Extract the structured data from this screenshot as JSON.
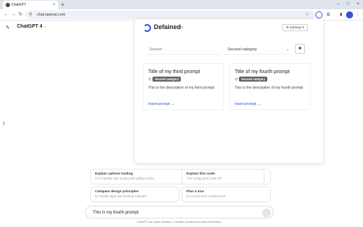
{
  "browser": {
    "tab_title": "ChatGPT",
    "tab_close": "×",
    "new_tab": "+",
    "url": "chat.openai.com",
    "window_controls": [
      "–",
      "□",
      "×"
    ],
    "nav": {
      "back": "←",
      "forward": "→",
      "reload": "↻"
    }
  },
  "chat": {
    "model_title": "ChatGPT 4",
    "suggestions": [
      {
        "title": "Explain options trading",
        "subtitle": "if I'm familiar with buying and selling stocks"
      },
      {
        "title": "Explain this code:",
        "subtitle": "\"cat config.yaml | awk NF\""
      },
      {
        "title": "Compare design principles",
        "subtitle": "for mobile apps and desktop software"
      },
      {
        "title": "Plan a tour",
        "subtitle": "for a food lover in Barcelona"
      }
    ],
    "composer_text": "This is my fourth prompt",
    "footer": "ChatGPT can make mistakes. Consider checking important information."
  },
  "panel": {
    "brand": "Defained",
    "beta": "Beta",
    "settings_label": "Settings",
    "search_placeholder": "Search",
    "category_selected": "Second category",
    "cards": [
      {
        "title": "Title of my third prompt",
        "badge": "Second category",
        "description": "This is the description of my third prompt",
        "insert": "Insert prompt →"
      },
      {
        "title": "Title of my fourth prompt",
        "badge": "Second category",
        "description": "This is the description of my fourth prompt",
        "insert": "Insert prompt →"
      }
    ]
  },
  "colors": {
    "accent": "#2b50e8",
    "badge": "#5f6368"
  }
}
